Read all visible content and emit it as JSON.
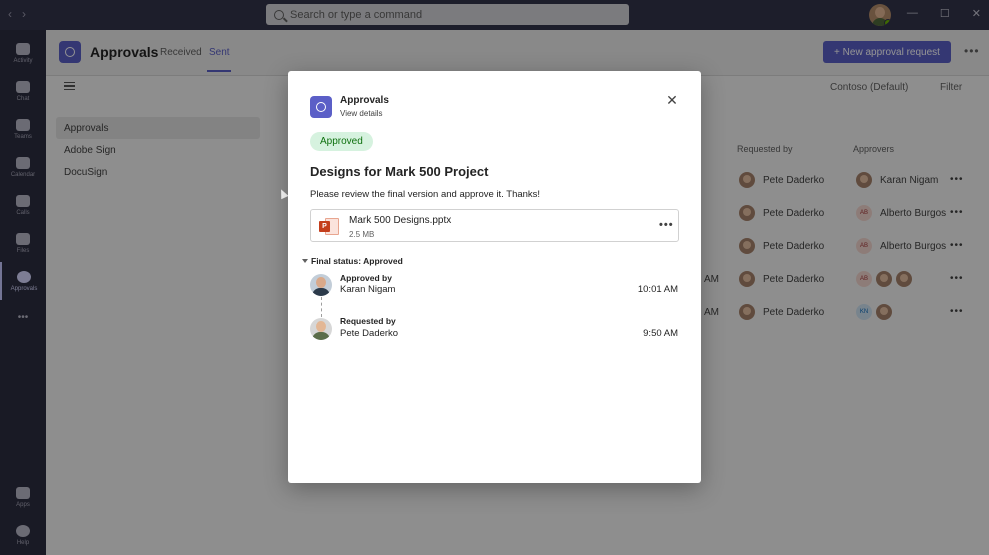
{
  "titlebar": {
    "search_placeholder": "Search or type a command",
    "back": "‹",
    "forward": "›",
    "minimize": "—",
    "maximize": "☐",
    "close": "✕"
  },
  "rail": {
    "items": [
      {
        "label": "Activity",
        "icon": "bell-icon"
      },
      {
        "label": "Chat",
        "icon": "chat-icon"
      },
      {
        "label": "Teams",
        "icon": "teams-icon"
      },
      {
        "label": "Calendar",
        "icon": "calendar-icon"
      },
      {
        "label": "Calls",
        "icon": "phone-icon"
      },
      {
        "label": "Files",
        "icon": "file-icon"
      },
      {
        "label": "Approvals",
        "icon": "approvals-icon"
      }
    ],
    "more": "•••",
    "apps": "Apps",
    "help": "Help"
  },
  "app_header": {
    "title": "Approvals",
    "tabs": [
      {
        "label": "Received"
      },
      {
        "label": "Sent"
      }
    ],
    "new_button": "+ New approval request",
    "more": "•••"
  },
  "toolbar": {
    "tenant": "Contoso (Default)",
    "filter": "Filter"
  },
  "side_list": {
    "items": [
      {
        "label": "Approvals"
      },
      {
        "label": "Adobe Sign"
      },
      {
        "label": "DocuSign"
      }
    ]
  },
  "table": {
    "headers": {
      "requested_by": "Requested by",
      "approvers": "Approvers"
    },
    "rows": [
      {
        "requested_by": "Pete Daderko",
        "approver": "Karan Nigam",
        "approver_initials": "",
        "time": ""
      },
      {
        "requested_by": "Pete Daderko",
        "approver": "Alberto Burgos",
        "approver_initials": "AB",
        "time": ""
      },
      {
        "requested_by": "Pete Daderko",
        "approver": "Alberto Burgos",
        "approver_initials": "AB",
        "time": ""
      },
      {
        "requested_by": "Pete Daderko",
        "approver": "",
        "approver_initials": "AB",
        "time": "AM"
      },
      {
        "requested_by": "Pete Daderko",
        "approver": "",
        "approver_initials": "KN",
        "time": "AM"
      }
    ],
    "row_more": "•••"
  },
  "dialog": {
    "app_name": "Approvals",
    "view_details": "View details",
    "close": "✕",
    "status_badge": "Approved",
    "title": "Designs for Mark 500 Project",
    "message": "Please review the final version and approve it. Thanks!",
    "file": {
      "name": "Mark 500 Designs.pptx",
      "size": "2.5 MB",
      "icon_letter": "P",
      "more": "•••"
    },
    "final_status": "Final status: Approved",
    "steps": [
      {
        "label": "Approved by",
        "name": "Karan Nigam",
        "time": "10:01 AM"
      },
      {
        "label": "Requested by",
        "name": "Pete Daderko",
        "time": "9:50 AM"
      }
    ]
  },
  "colors": {
    "brand": "#5b5fc7",
    "approved_bg": "#d6f2df",
    "approved_text": "#0e700e",
    "titlebar": "#33344a"
  }
}
